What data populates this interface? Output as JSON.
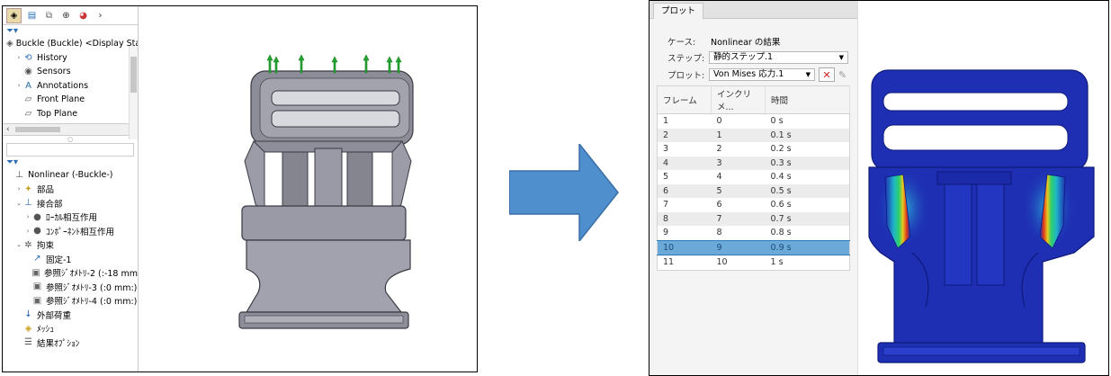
{
  "left_window": {
    "feature_tree": {
      "part_root": "Buckle (Buckle) <Display State",
      "part_items": [
        {
          "label": "History",
          "icon": "history-icon"
        },
        {
          "label": "Sensors",
          "icon": "sensors-icon"
        },
        {
          "label": "Annotations",
          "icon": "annotations-icon"
        },
        {
          "label": "Front Plane",
          "icon": "plane-icon"
        },
        {
          "label": "Top Plane",
          "icon": "plane-icon"
        }
      ],
      "study_root": "Nonlinear (-Buckle-)",
      "study_items": [
        {
          "label": "部品",
          "icon": "parts-icon",
          "indent": 1
        },
        {
          "label": "接合部",
          "icon": "connections-icon",
          "indent": 1
        },
        {
          "label": "ﾛｰｶﾙ相互作用",
          "icon": "local-interaction-icon",
          "indent": 2
        },
        {
          "label": "ｺﾝﾎﾟｰﾈﾝﾄ相互作用",
          "icon": "component-interaction-icon",
          "indent": 2
        },
        {
          "label": "拘束",
          "icon": "fixtures-icon",
          "indent": 1
        },
        {
          "label": "固定-1",
          "icon": "fixed-icon",
          "indent": 2
        },
        {
          "label": "参照ｼﾞｵﾒﾄﾘ-2 (:-18 mm",
          "icon": "reference-geometry-icon",
          "indent": 2
        },
        {
          "label": "参照ｼﾞｵﾒﾄﾘ-3 (:0 mm:)",
          "icon": "reference-geometry-icon",
          "indent": 2
        },
        {
          "label": "参照ｼﾞｵﾒﾄﾘ-4 (:0 mm:)",
          "icon": "reference-geometry-icon",
          "indent": 2
        },
        {
          "label": "外部荷重",
          "icon": "external-loads-icon",
          "indent": 1
        },
        {
          "label": "ﾒｯｼｭ",
          "icon": "mesh-icon",
          "indent": 1
        },
        {
          "label": "結果ｵﾌﾟｼｮﾝ",
          "icon": "result-options-icon",
          "indent": 1
        }
      ]
    }
  },
  "right_window": {
    "tab_label": "プロット",
    "case_label": "ケース:",
    "case_value": "Nonlinear の結果",
    "step_label": "ステップ:",
    "step_value": "静的ステップ.1",
    "plot_label": "プロット:",
    "plot_value": "Von Mises 応力.1",
    "table": {
      "headers": [
        "フレーム",
        "インクリメ...",
        "時間"
      ],
      "rows": [
        [
          "1",
          "0",
          "0 s"
        ],
        [
          "2",
          "1",
          "0.1 s"
        ],
        [
          "3",
          "2",
          "0.2 s"
        ],
        [
          "4",
          "3",
          "0.3 s"
        ],
        [
          "5",
          "4",
          "0.4 s"
        ],
        [
          "6",
          "5",
          "0.5 s"
        ],
        [
          "7",
          "6",
          "0.6 s"
        ],
        [
          "8",
          "7",
          "0.7 s"
        ],
        [
          "9",
          "8",
          "0.8 s"
        ],
        [
          "10",
          "9",
          "0.9 s"
        ],
        [
          "11",
          "10",
          "1 s"
        ]
      ],
      "selected_row": 9
    }
  },
  "colors": {
    "arrow": "#4f8fcd",
    "selection": "#6aa9d8",
    "mesh_blue": "#1e2fb4",
    "part_gray": "#9a9aa6"
  }
}
